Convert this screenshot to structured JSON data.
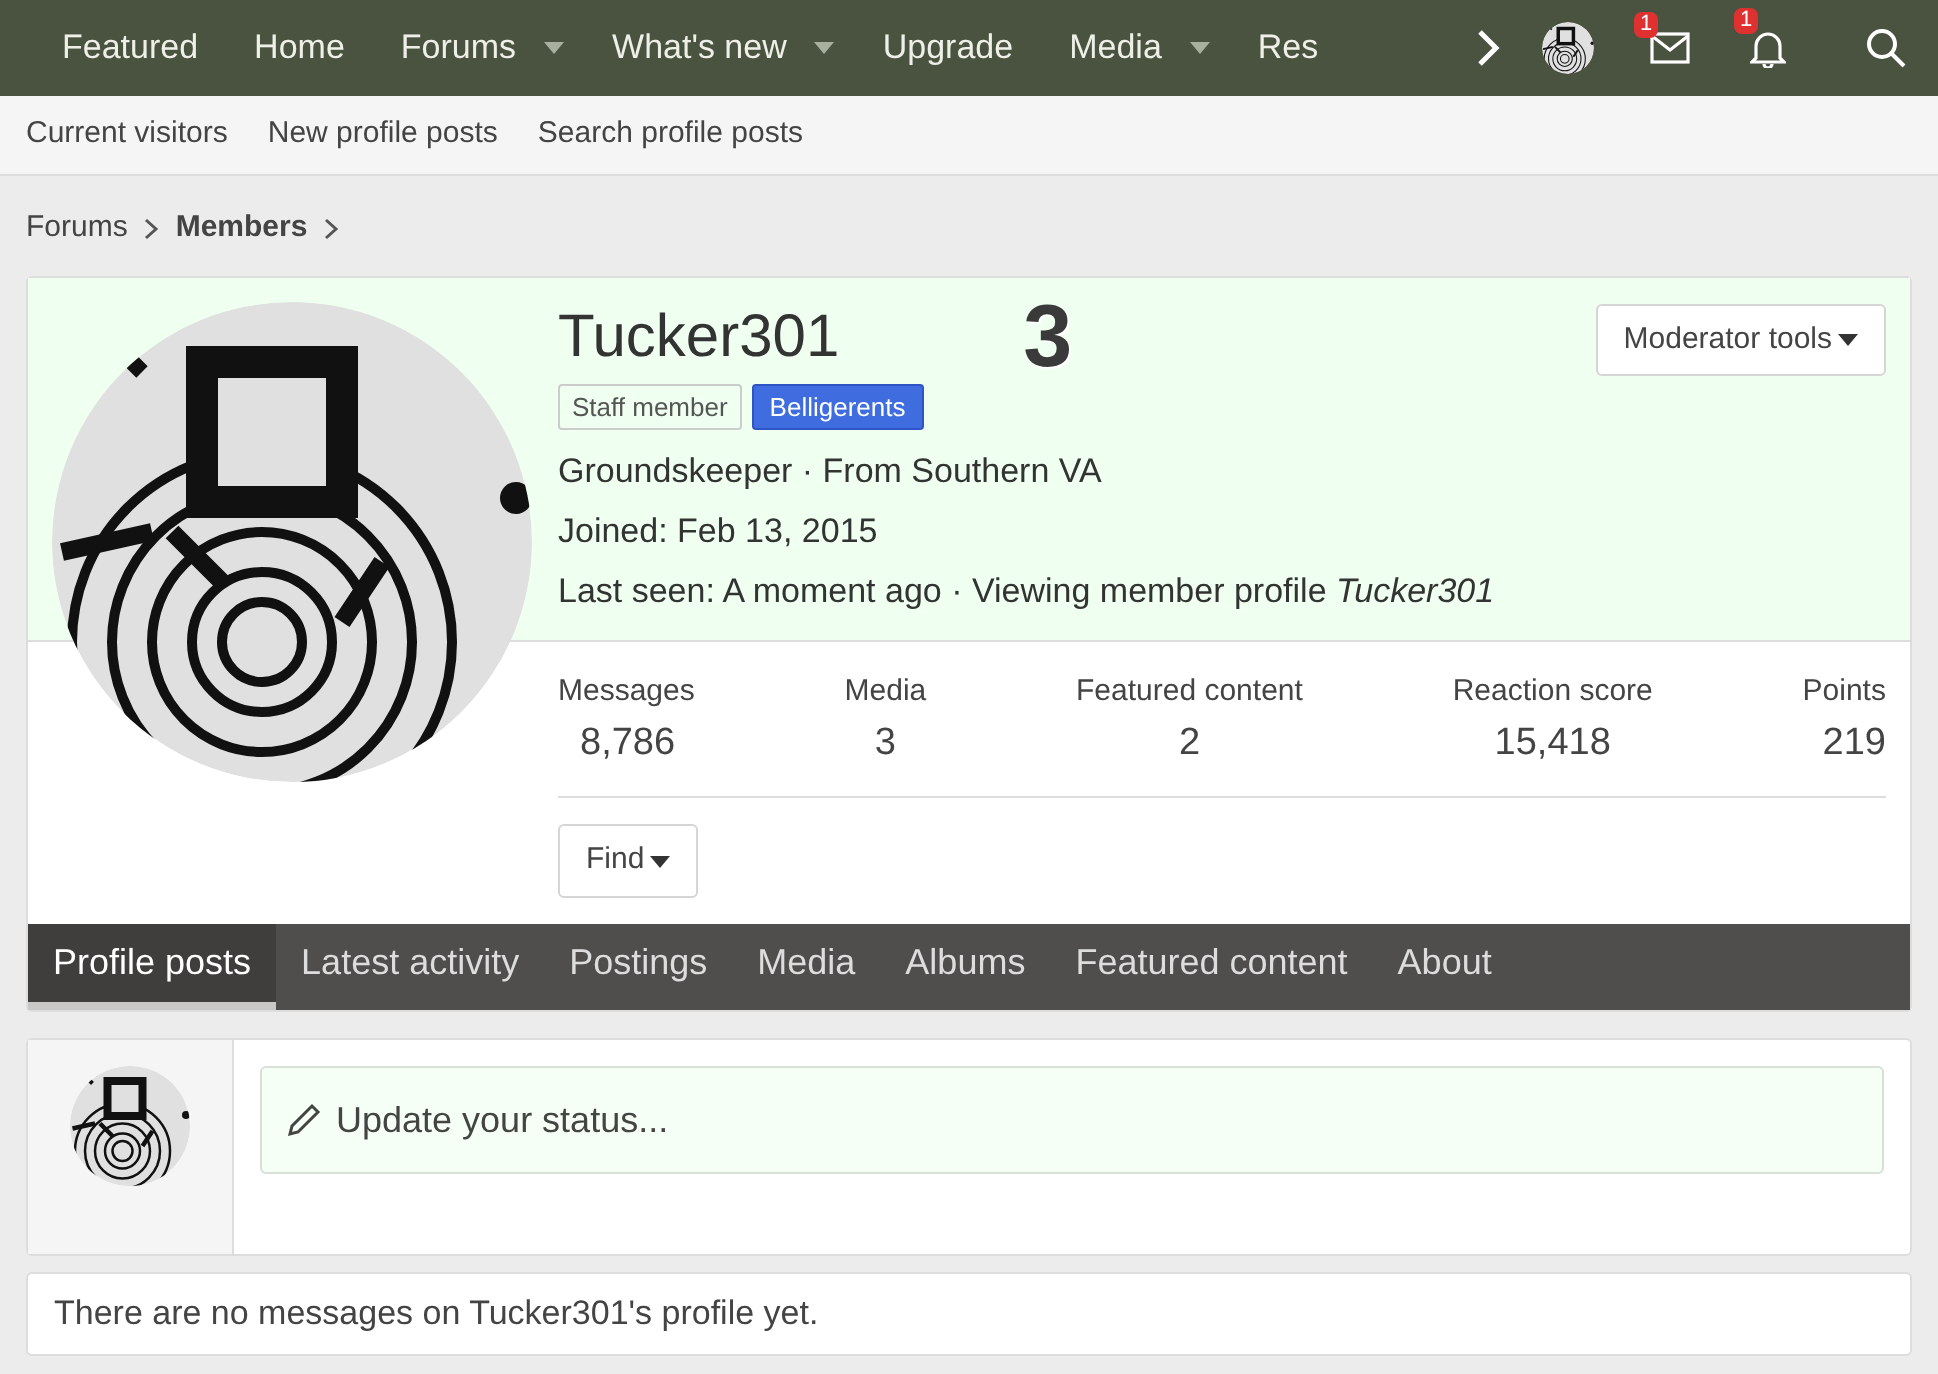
{
  "nav": {
    "items": [
      {
        "label": "Featured",
        "dropdown": false
      },
      {
        "label": "Home",
        "dropdown": false
      },
      {
        "label": "Forums",
        "dropdown": true
      },
      {
        "label": "What's new",
        "dropdown": true
      },
      {
        "label": "Upgrade",
        "dropdown": false
      },
      {
        "label": "Media",
        "dropdown": true
      },
      {
        "label": "Res",
        "dropdown": false
      }
    ],
    "inbox_badge": "1",
    "alerts_badge": "1"
  },
  "subnav": [
    "Current visitors",
    "New profile posts",
    "Search profile posts"
  ],
  "breadcrumb": [
    {
      "label": "Forums",
      "current": false
    },
    {
      "label": "Members",
      "current": true
    }
  ],
  "profile": {
    "username": "Tucker301",
    "annotation": "3",
    "moderator_button": "Moderator tools",
    "banners": [
      {
        "label": "Staff member",
        "kind": "plain"
      },
      {
        "label": "Belligerents",
        "kind": "blue"
      }
    ],
    "blurb": "Groundskeeper · From Southern VA",
    "joined": "Joined: Feb 13, 2015",
    "last_seen": "Last seen: A moment ago · Viewing member profile *Tucker301*",
    "stats": [
      {
        "label": "Messages",
        "value": "8,786"
      },
      {
        "label": "Media",
        "value": "3"
      },
      {
        "label": "Featured content",
        "value": "2"
      },
      {
        "label": "Reaction score",
        "value": "15,418"
      },
      {
        "label": "Points",
        "value": "219"
      }
    ],
    "find_button": "Find"
  },
  "tabs": [
    {
      "label": "Profile posts",
      "selected": true
    },
    {
      "label": "Latest activity",
      "selected": false
    },
    {
      "label": "Postings",
      "selected": false
    },
    {
      "label": "Media",
      "selected": false
    },
    {
      "label": "Albums",
      "selected": false
    },
    {
      "label": "Featured content",
      "selected": false
    },
    {
      "label": "About",
      "selected": false
    }
  ],
  "status": {
    "placeholder": "Update your status..."
  },
  "empty_message": "There are no messages on Tucker301's profile yet."
}
